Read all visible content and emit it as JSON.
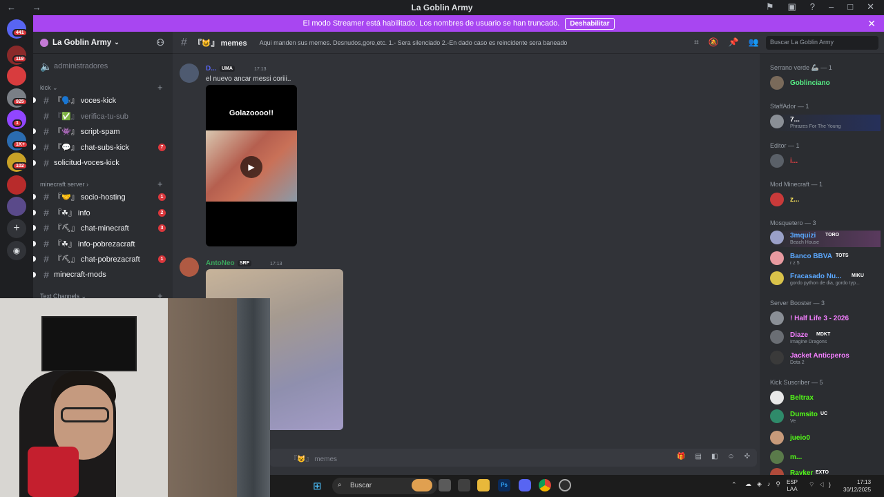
{
  "window": {
    "title": "La Goblin Army"
  },
  "banner": {
    "text": "El modo Streamer está habilitado. Los nombres de usuario se han truncado.",
    "button": "Deshabilitar"
  },
  "guild_badges": [
    "441",
    "119",
    "925",
    "1",
    "1K+",
    "102"
  ],
  "server": {
    "name": "La Goblin Army",
    "top_channel": "administradores",
    "categories": [
      {
        "name": "kick",
        "channels": [
          {
            "name": "『🗣️』 voces-kick",
            "badge": ""
          },
          {
            "name": "『✅』 verifica-tu-sub",
            "badge": ""
          },
          {
            "name": "『👾』 script-spam",
            "badge": ""
          },
          {
            "name": "『💬』 chat-subs-kick",
            "badge": "7"
          },
          {
            "name": "solicitud-voces-kick",
            "badge": ""
          }
        ]
      },
      {
        "name": "minecraft server",
        "channels": [
          {
            "name": "『🤝』 socio-hosting",
            "badge": "1"
          },
          {
            "name": "『☘』 info",
            "badge": "2"
          },
          {
            "name": "『⛏』 chat-minecraft",
            "badge": "3"
          },
          {
            "name": "『☘』 info-pobrezacraft",
            "badge": ""
          },
          {
            "name": "『⛏』 chat-pobrezacraft",
            "badge": "1"
          },
          {
            "name": "minecraft-mods",
            "badge": ""
          }
        ]
      },
      {
        "name": "Text Channels",
        "channels": []
      }
    ]
  },
  "channel_header": {
    "name": "『😺』 memes",
    "topic": "Aqui manden sus memes. Desnudos,gore,etc. 1.- Sera silenciado 2.-En dado caso es reincidente sera baneado",
    "search_placeholder": "Buscar La Goblin Army"
  },
  "messages": [
    {
      "author": "D...",
      "tag": "UMA",
      "time": "17:13",
      "text": "el nuevo ancar messi coriii..",
      "video_caption": "Golazoooo!!",
      "color": "#5865f2"
    },
    {
      "author": "AntoNeo",
      "tag": "SRF",
      "time": "17:13",
      "text": "",
      "color": "#3ba55c"
    }
  ],
  "input_placeholder": "『😺』 memes",
  "members": [
    {
      "category": "Serrano verde 🦾 — 1",
      "people": [
        {
          "name": "Goblinciano",
          "status": "",
          "tag": "",
          "color": "#57f287"
        }
      ]
    },
    {
      "category": "StaffAdor — 1",
      "people": [
        {
          "name": "7...",
          "status": "Phrazes For The Young",
          "tag": "",
          "color": "#ffffff"
        }
      ]
    },
    {
      "category": "Editor — 1",
      "people": [
        {
          "name": "i...",
          "status": "",
          "tag": "",
          "color": "#ed4245"
        }
      ]
    },
    {
      "category": "Mod Minecraft — 1",
      "people": [
        {
          "name": "z...",
          "status": "",
          "tag": "",
          "color": "#fee75c"
        }
      ]
    },
    {
      "category": "Mosquetero — 3",
      "people": [
        {
          "name": "3mquizi",
          "status": "Beach House",
          "tag": "TORO",
          "color": "#5ba8ff"
        },
        {
          "name": "Banco BBVA",
          "status": "r z 5",
          "tag": "TOTS",
          "color": "#5ba8ff"
        },
        {
          "name": "Fracasado Nu...",
          "status": "gordo python de dia, gordo typ...",
          "tag": "MIKU",
          "color": "#5ba8ff"
        }
      ]
    },
    {
      "category": "Server Booster — 3",
      "people": [
        {
          "name": "! Half Life 3 - 2026",
          "status": "",
          "tag": "",
          "color": "#f47fff"
        },
        {
          "name": "Diaze",
          "status": "Imagine Dragons",
          "tag": "MDKT",
          "color": "#f47fff"
        },
        {
          "name": "Jacket Anticperos",
          "status": "Dota 2",
          "tag": "",
          "color": "#f47fff"
        }
      ]
    },
    {
      "category": "Kick Suscriber — 5",
      "people": [
        {
          "name": "Beltrax",
          "status": "",
          "tag": "",
          "color": "#53fc18"
        },
        {
          "name": "Dumsito",
          "status": "Ve",
          "tag": "UC",
          "color": "#53fc18"
        },
        {
          "name": "jueio0",
          "status": "",
          "tag": "",
          "color": "#53fc18"
        },
        {
          "name": "m...",
          "status": "",
          "tag": "",
          "color": "#53fc18"
        },
        {
          "name": "Rayker",
          "status": "",
          "tag": "EXTO",
          "color": "#53fc18"
        }
      ]
    }
  ],
  "taskbar": {
    "search": "Buscar",
    "lang": "ESP",
    "layout": "LAA",
    "time": "17:13",
    "date": "30/12/2025"
  }
}
